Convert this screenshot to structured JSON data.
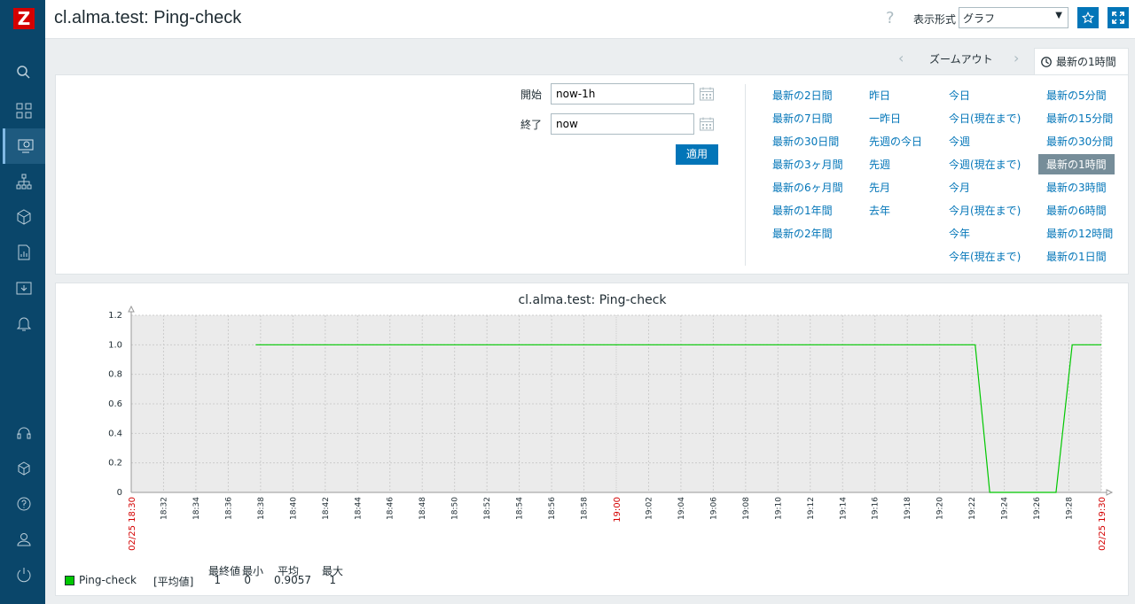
{
  "header": {
    "title": "cl.alma.test: Ping-check",
    "help": "?",
    "view_label": "表示形式",
    "view_value": "グラフ"
  },
  "sidebar": {
    "logo": "Z",
    "icons": [
      "search-icon",
      "dashboard-icon",
      "monitoring-icon",
      "network-icon",
      "inventory-icon",
      "reports-icon",
      "data-collection-icon",
      "alerts-icon",
      "support-icon",
      "integrations-icon",
      "help-icon",
      "user-icon",
      "logout-icon"
    ]
  },
  "tabbar": {
    "zoom_out": "ズームアウト",
    "time_tab": "最新の1時間"
  },
  "filter": {
    "from_label": "開始",
    "from_value": "now-1h",
    "to_label": "終了",
    "to_value": "now",
    "apply": "適用",
    "columns": [
      [
        "最新の2日間",
        "最新の7日間",
        "最新の30日間",
        "最新の3ヶ月間",
        "最新の6ヶ月間",
        "最新の1年間",
        "最新の2年間"
      ],
      [
        "昨日",
        "一昨日",
        "先週の今日",
        "先週",
        "先月",
        "去年"
      ],
      [
        "今日",
        "今日(現在まで)",
        "今週",
        "今週(現在まで)",
        "今月",
        "今月(現在まで)",
        "今年",
        "今年(現在まで)"
      ],
      [
        "最新の5分間",
        "最新の15分間",
        "最新の30分間",
        "最新の1時間",
        "最新の3時間",
        "最新の6時間",
        "最新の12時間",
        "最新の1日間"
      ]
    ],
    "selected": "最新の1時間"
  },
  "chart_data": {
    "type": "line",
    "title": "cl.alma.test: Ping-check",
    "ylim": [
      0,
      1.2
    ],
    "y_ticks": [
      "0",
      "0.2",
      "0.4",
      "0.6",
      "0.8",
      "1.0",
      "1.2"
    ],
    "x_start_label": "02/25 18:30",
    "x_end_label": "02/25 19:30",
    "x_mid_label": "19:00",
    "x_ticks": [
      "18:32",
      "18:34",
      "18:36",
      "18:38",
      "18:40",
      "18:42",
      "18:44",
      "18:46",
      "18:48",
      "18:50",
      "18:52",
      "18:54",
      "18:56",
      "18:58",
      "19:02",
      "19:04",
      "19:06",
      "19:08",
      "19:10",
      "19:12",
      "19:14",
      "19:16",
      "19:18",
      "19:20",
      "19:22",
      "19:24",
      "19:26",
      "19:28"
    ],
    "series": [
      {
        "name": "Ping-check",
        "color": "#00c800",
        "x_minutes": [
          7.7,
          52.2,
          53.1,
          57.2,
          58.2,
          60.0
        ],
        "values": [
          1,
          1,
          0,
          0,
          1,
          1
        ]
      }
    ],
    "legend": {
      "name": "Ping-check",
      "unit": "[平均値]",
      "headers": [
        "最終値",
        "最小",
        "平均",
        "最大"
      ],
      "values": [
        "1",
        "0",
        "0.9057",
        "1"
      ]
    },
    "colors": {
      "grid": "#cccccc",
      "plot_bg": "#ebebeb",
      "mark_red": "#d40000"
    }
  }
}
